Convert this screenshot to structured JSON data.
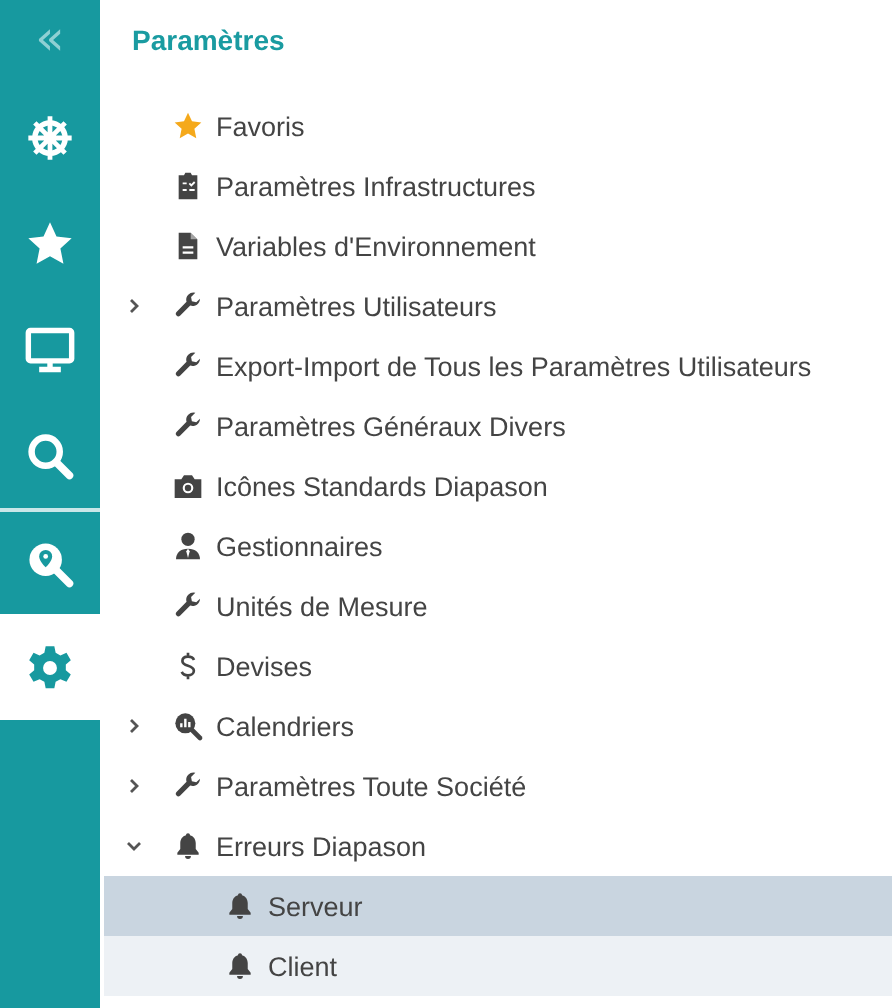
{
  "sidebar": {
    "collapse": "«",
    "items": [
      {
        "kind": "wheel",
        "selected": false
      },
      {
        "kind": "star",
        "selected": false
      },
      {
        "kind": "monitor",
        "selected": false
      },
      {
        "kind": "search",
        "selected": false
      },
      {
        "kind": "map-search",
        "selected": false
      },
      {
        "kind": "gear",
        "selected": true
      }
    ]
  },
  "panel": {
    "title": "Paramètres",
    "tree": [
      {
        "label": "Favoris",
        "kind": "star",
        "selected": false
      },
      {
        "label": "Paramètres Infrastructures",
        "kind": "clipboard",
        "selected": false
      },
      {
        "label": "Variables d'Environnement",
        "kind": "file",
        "selected": false
      },
      {
        "label": "Paramètres Utilisateurs",
        "kind": "wrench",
        "expanded": false,
        "selected": false
      },
      {
        "label": "Export-Import de Tous les Paramètres Utilisateurs",
        "kind": "wrench",
        "selected": false
      },
      {
        "label": "Paramètres Généraux Divers",
        "kind": "wrench",
        "selected": false
      },
      {
        "label": "Icônes Standards Diapason",
        "kind": "camera",
        "selected": false
      },
      {
        "label": "Gestionnaires",
        "kind": "person",
        "selected": false
      },
      {
        "label": "Unités de Mesure",
        "kind": "wrench",
        "selected": false
      },
      {
        "label": "Devises",
        "kind": "dollar",
        "selected": false
      },
      {
        "label": "Calendriers",
        "kind": "chart-search",
        "expanded": false,
        "selected": false
      },
      {
        "label": "Paramètres Toute Société",
        "kind": "wrench",
        "expanded": false,
        "selected": false
      },
      {
        "label": "Erreurs Diapason",
        "kind": "bell",
        "expanded": true,
        "selected": false,
        "children": [
          {
            "label": "Serveur",
            "kind": "bell",
            "selected": true
          },
          {
            "label": "Client",
            "kind": "bell",
            "selected": false,
            "hovered": true
          }
        ]
      }
    ]
  }
}
